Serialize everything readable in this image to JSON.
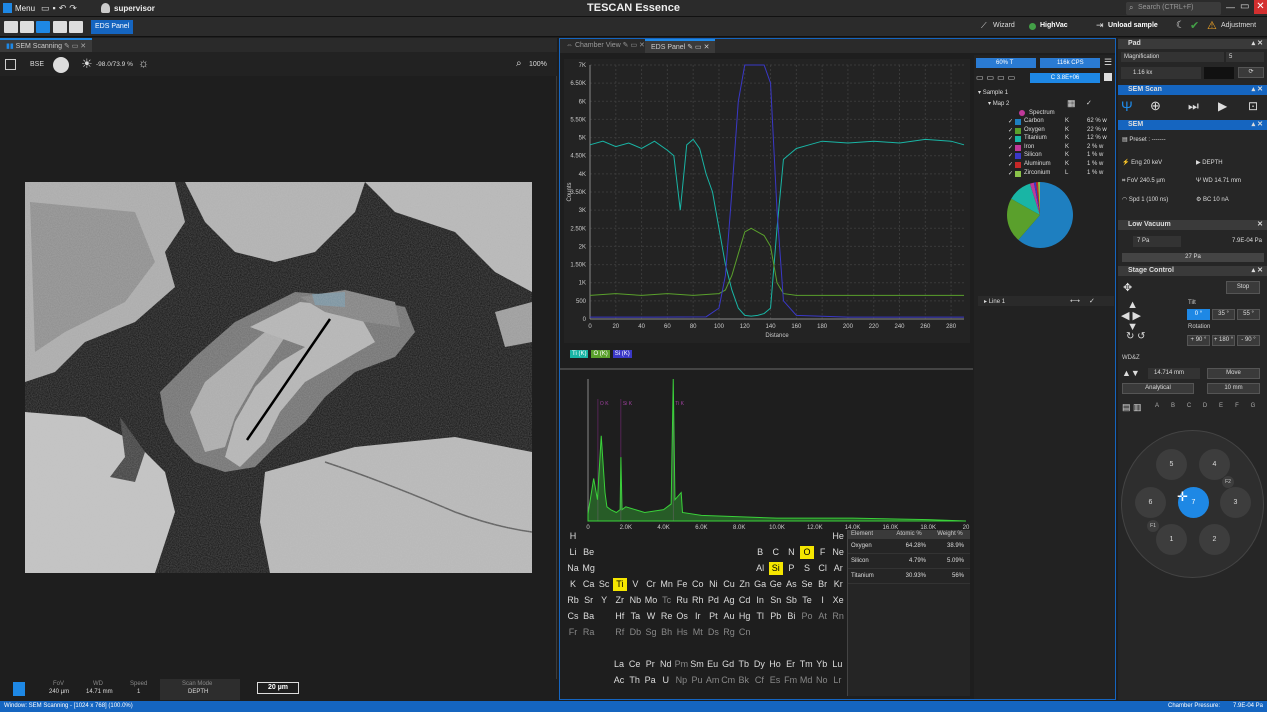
{
  "app": {
    "title": "TESCAN Essence",
    "menu": "Menu",
    "user": "supervisor",
    "search_placeholder": "Search (CTRL+F)"
  },
  "toolbar": {
    "eds_panel": "EDS Panel",
    "wizard": "Wizard",
    "highvac": "HighVac",
    "unload": "Unload sample",
    "adjustment": "Adjustment"
  },
  "sem_tab": {
    "title": "SEM Scanning",
    "detector": "BSE",
    "brightness": "-98.0/73.9 %",
    "zoom": "100%"
  },
  "bottom": {
    "fov_label": "FoV",
    "fov": "240 µm",
    "wd_label": "WD",
    "wd": "14.71 mm",
    "speed_label": "Speed",
    "speed": "1",
    "scan_mode_label": "Scan Mode",
    "scan_mode": "DEPTH",
    "scale": "20 µm"
  },
  "status": {
    "window": "Window: SEM Scanning - [1024 x 768] (100.0%)",
    "pressure_label": "Chamber Pressure:",
    "pressure": "7.9E-04 Pa"
  },
  "eds_tabs": {
    "chamber": "Chamber View",
    "eds": "EDS Panel"
  },
  "eds_top": {
    "mode": "60% T",
    "cps": "116k CPS",
    "counts": "C 3.8E+06"
  },
  "tree": {
    "sample": "Sample 1",
    "map": "Map 2",
    "spectrum": "Spectrum",
    "line": "Line 1"
  },
  "elements": [
    {
      "name": "Carbon",
      "line": "K",
      "pct": "62 % w",
      "color": "#1e7fc0"
    },
    {
      "name": "Oxygen",
      "line": "K",
      "pct": "22 % w",
      "color": "#5aa02c"
    },
    {
      "name": "Titanium",
      "line": "K",
      "pct": "12 % w",
      "color": "#19b5a5"
    },
    {
      "name": "Iron",
      "line": "K",
      "pct": "2 % w",
      "color": "#c0399a"
    },
    {
      "name": "Silicon",
      "line": "K",
      "pct": "1 % w",
      "color": "#3a38c7"
    },
    {
      "name": "Aluminum",
      "line": "K",
      "pct": "1 % w",
      "color": "#c62828"
    },
    {
      "name": "Zirconium",
      "line": "L",
      "pct": "1 % w",
      "color": "#8bc34a"
    }
  ],
  "line_chips": [
    "Ti (K)",
    "O (K)",
    "Si (K)"
  ],
  "quant": {
    "headers": [
      "Element",
      "Atomic %",
      "Weight %"
    ],
    "rows": [
      [
        "Oxygen",
        "64.28%",
        "38.9%"
      ],
      [
        "Silicon",
        "4.79%",
        "5.09%"
      ],
      [
        "Titanium",
        "30.93%",
        "56%"
      ]
    ]
  },
  "chart_data": [
    {
      "type": "line",
      "title": "",
      "xlabel": "Distance",
      "ylabel": "Counts",
      "xlim": [
        0,
        290
      ],
      "ylim": [
        0,
        7000
      ],
      "x_ticks": [
        "0",
        "20",
        "40",
        "60",
        "80",
        "100",
        "120",
        "140",
        "160",
        "180",
        "200",
        "220",
        "240",
        "260",
        "280"
      ],
      "y_ticks": [
        "0",
        "500",
        "1K",
        "1.50K",
        "2K",
        "2.50K",
        "3K",
        "3.50K",
        "4K",
        "4.50K",
        "5K",
        "5.50K",
        "6K",
        "6.50K",
        "7K"
      ],
      "series": [
        {
          "name": "Ti (K)",
          "color": "#19b5a5",
          "x": [
            0,
            10,
            20,
            30,
            40,
            50,
            60,
            65,
            70,
            75,
            80,
            85,
            90,
            95,
            100,
            105,
            110,
            115,
            120,
            125,
            130,
            135,
            140,
            145,
            150,
            160,
            170,
            180,
            200,
            220,
            240,
            260,
            280,
            290
          ],
          "y": [
            4800,
            4900,
            4750,
            4850,
            4700,
            4900,
            4650,
            4500,
            3000,
            4800,
            4950,
            4700,
            4000,
            3500,
            2500,
            1500,
            800,
            300,
            100,
            80,
            100,
            150,
            300,
            2500,
            4400,
            4700,
            4800,
            4900,
            4850,
            4900,
            4850,
            4950,
            4900,
            4800
          ]
        },
        {
          "name": "O (K)",
          "color": "#5aa02c",
          "x": [
            0,
            20,
            40,
            60,
            80,
            100,
            105,
            110,
            115,
            120,
            125,
            130,
            135,
            140,
            145,
            150,
            160,
            200,
            240,
            290
          ],
          "y": [
            650,
            700,
            650,
            700,
            650,
            700,
            800,
            1200,
            1800,
            2400,
            2500,
            2400,
            2300,
            2000,
            1000,
            700,
            650,
            650,
            650,
            650
          ]
        },
        {
          "name": "Si (K)",
          "color": "#3a38c7",
          "x": [
            0,
            50,
            90,
            100,
            105,
            110,
            115,
            120,
            125,
            130,
            135,
            140,
            145,
            150,
            160,
            200,
            290
          ],
          "y": [
            50,
            50,
            60,
            300,
            1200,
            3500,
            6000,
            7000,
            7000,
            7000,
            7000,
            6500,
            3000,
            500,
            100,
            50,
            50
          ]
        }
      ]
    },
    {
      "type": "line",
      "title": "",
      "xlabel": "",
      "ylabel": "",
      "xlim": [
        0,
        20000
      ],
      "x_ticks": [
        "0",
        "2.0K",
        "4.0K",
        "6.0K",
        "8.0K",
        "10.0K",
        "12.0K",
        "14.0K",
        "16.0K",
        "18.0K",
        "20"
      ],
      "peak_labels": [
        "O K",
        "Si K",
        "Ti K"
      ],
      "series": [
        {
          "name": "Spectrum",
          "color": "#3ad13a",
          "x": [
            0,
            300,
            500,
            700,
            900,
            1000,
            1200,
            1500,
            1700,
            1740,
            1800,
            2000,
            3000,
            4000,
            4400,
            4510,
            4600,
            4930,
            5000,
            6000,
            8000,
            10000,
            14000,
            18000,
            20000
          ],
          "y": [
            5,
            30,
            15,
            60,
            20,
            10,
            8,
            6,
            8,
            45,
            8,
            10,
            6,
            8,
            12,
            100,
            15,
            20,
            6,
            4,
            3,
            2,
            2,
            1,
            0
          ]
        }
      ]
    },
    {
      "type": "pie",
      "categories": [
        "Carbon",
        "Oxygen",
        "Titanium",
        "Iron",
        "Silicon",
        "Aluminum",
        "Zirconium"
      ],
      "values": [
        62,
        22,
        12,
        2,
        1,
        1,
        1
      ]
    }
  ],
  "periodic": [
    [
      "H",
      "",
      "",
      "",
      "",
      "",
      "",
      "",
      "",
      "",
      "",
      "",
      "",
      "",
      "",
      "",
      "",
      "He"
    ],
    [
      "Li",
      "Be",
      "",
      "",
      "",
      "",
      "",
      "",
      "",
      "",
      "",
      "",
      "B",
      "C",
      "N",
      "O",
      "F",
      "Ne"
    ],
    [
      "Na",
      "Mg",
      "",
      "",
      "",
      "",
      "",
      "",
      "",
      "",
      "",
      "",
      "Al",
      "Si",
      "P",
      "S",
      "Cl",
      "Ar"
    ],
    [
      "K",
      "Ca",
      "Sc",
      "Ti",
      "V",
      "Cr",
      "Mn",
      "Fe",
      "Co",
      "Ni",
      "Cu",
      "Zn",
      "Ga",
      "Ge",
      "As",
      "Se",
      "Br",
      "Kr"
    ],
    [
      "Rb",
      "Sr",
      "Y",
      "Zr",
      "Nb",
      "Mo",
      "Tc",
      "Ru",
      "Rh",
      "Pd",
      "Ag",
      "Cd",
      "In",
      "Sn",
      "Sb",
      "Te",
      "I",
      "Xe"
    ],
    [
      "Cs",
      "Ba",
      "",
      "Hf",
      "Ta",
      "W",
      "Re",
      "Os",
      "Ir",
      "Pt",
      "Au",
      "Hg",
      "Tl",
      "Pb",
      "Bi",
      "Po",
      "At",
      "Rn"
    ],
    [
      "Fr",
      "Ra",
      "",
      "Rf",
      "Db",
      "Sg",
      "Bh",
      "Hs",
      "Mt",
      "Ds",
      "Rg",
      "Cn",
      "",
      "",
      "",
      "",
      "",
      ""
    ]
  ],
  "lanth": [
    "La",
    "Ce",
    "Pr",
    "Nd",
    "Pm",
    "Sm",
    "Eu",
    "Gd",
    "Tb",
    "Dy",
    "Ho",
    "Er",
    "Tm",
    "Yb",
    "Lu"
  ],
  "actin": [
    "Ac",
    "Th",
    "Pa",
    "U",
    "Np",
    "Pu",
    "Am",
    "Cm",
    "Bk",
    "Cf",
    "Es",
    "Fm",
    "Md",
    "No",
    "Lr"
  ],
  "right": {
    "pad": "Pad",
    "magnification": "Magnification",
    "mag_val": "5",
    "mag_kx": "1.16 kx",
    "sem_scan": "SEM Scan",
    "sem": "SEM",
    "preset": "Preset : -------",
    "eng": "Eng 20 keV",
    "depth": "DEPTH",
    "fov": "FoV 240.5 µm",
    "wd": "WD 14.71 mm",
    "spd": "Spd 1 (100 ns)",
    "bc": "BC 10 nA",
    "low_vacuum": "Low Vacuum",
    "lv_set": "7 Pa",
    "lv_read": "7.9E-04 Pa",
    "lv_slider": "27 Pa",
    "stage": "Stage Control",
    "stop": "Stop",
    "tilt": "Tilt",
    "tilt_opts": [
      "0 °",
      "35 °",
      "55 °"
    ],
    "rotation": "Rotation",
    "rot_opts": [
      "+ 90 °",
      "+ 180 °",
      "- 90 °"
    ],
    "wdz": "WD&Z",
    "wd_val": "14.714 mm",
    "move": "Move",
    "analytical": "Analytical",
    "ten_mm": "10 mm",
    "letters": [
      "A",
      "B",
      "C",
      "D",
      "E",
      "F",
      "G"
    ],
    "holders": [
      "5",
      "4",
      "6",
      "7",
      "3",
      "1",
      "2"
    ],
    "f1": "F1",
    "f2": "F2"
  }
}
